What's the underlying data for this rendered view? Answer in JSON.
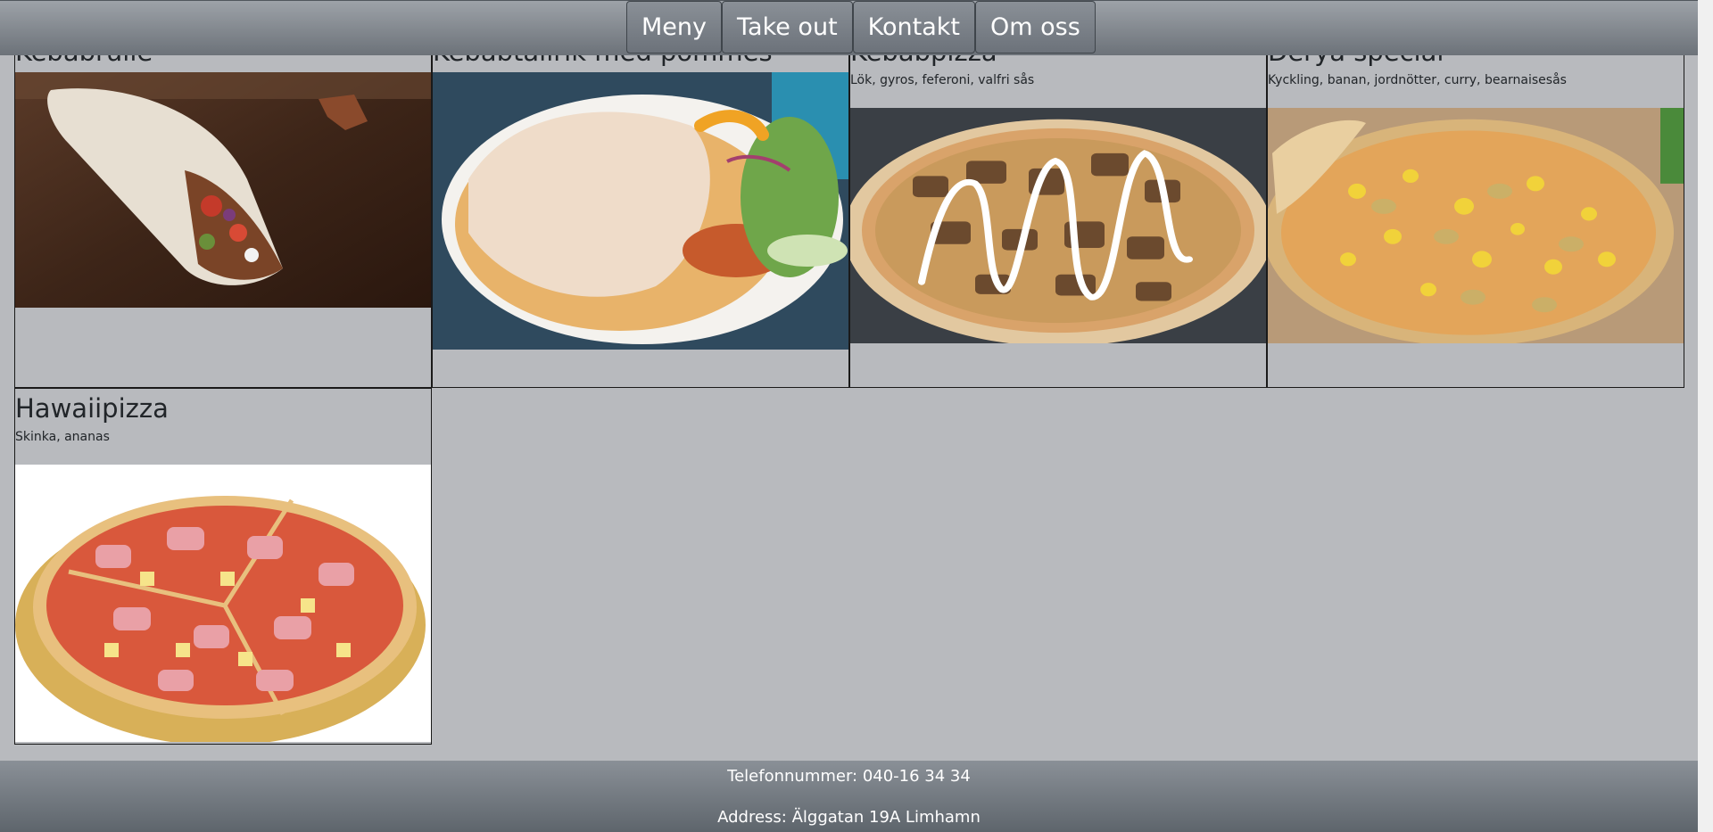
{
  "nav": {
    "links": [
      "Meny",
      "Take out",
      "Kontakt",
      "Om oss"
    ]
  },
  "menu": {
    "items": [
      {
        "name": "Kebabrulle",
        "desc": ""
      },
      {
        "name": "Kebabtallrik med pommes",
        "desc": ""
      },
      {
        "name": "Kebabpizza",
        "desc": "Lök, gyros, feferoni, valfri sås"
      },
      {
        "name": "Derya special",
        "desc": "Kyckling, banan, jordnötter, curry, bearnaisesås"
      },
      {
        "name": "Hawaiipizza",
        "desc": "Skinka, ananas"
      }
    ]
  },
  "footer": {
    "phone": "Telefonnummer: 040-16 34 34",
    "address": "Address: Älggatan 19A Limhamn"
  }
}
